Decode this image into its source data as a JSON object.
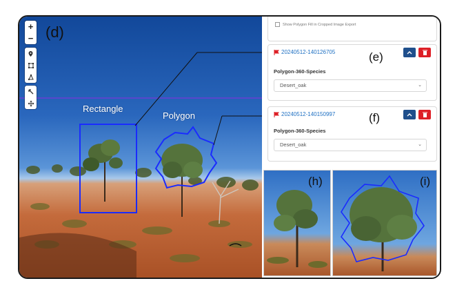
{
  "map": {
    "panel_letter": "(d)",
    "zoom_in": "+",
    "zoom_out": "−",
    "tools": [
      "marker-icon",
      "rectangle-draw-icon",
      "polygon-draw-icon",
      "edit-icon",
      "move-icon"
    ],
    "labels": {
      "rectangle": "Rectangle",
      "polygon": "Polygon"
    },
    "shape_color": "#1a2bff"
  },
  "settings": {
    "show_polygon_fill_label": "Show Polygon Fill in Cropped Image Export",
    "checked": false
  },
  "annotations": [
    {
      "panel_letter": "(e)",
      "id": "20240512-140126705",
      "field_label": "Polygon-360-Species",
      "species": "Desert_oak"
    },
    {
      "panel_letter": "(f)",
      "id": "20240512-140150997",
      "field_label": "Polygon-360-Species",
      "species": "Desert_oak"
    }
  ],
  "crops": [
    {
      "panel_letter": "(h)"
    },
    {
      "panel_letter": "(i)"
    }
  ],
  "colors": {
    "accent": "#1f4f8c",
    "danger": "#dd1f26",
    "link": "#1d6fc2",
    "horizon_line": "#8a2be2"
  }
}
